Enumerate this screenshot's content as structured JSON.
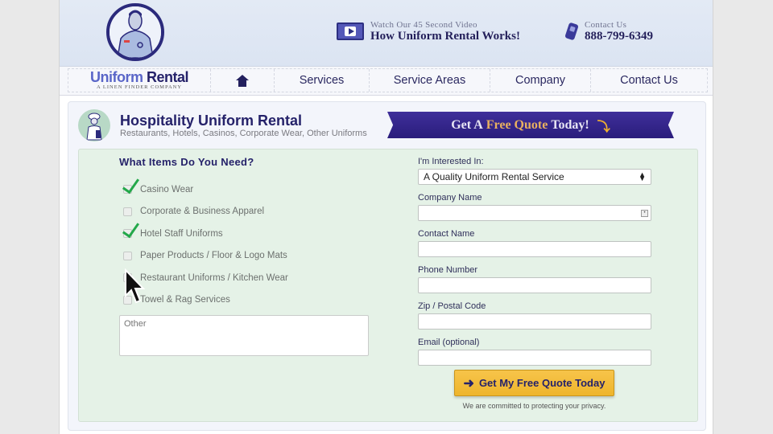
{
  "header": {
    "video_small": "Watch Our 45 Second Video",
    "video_big": "How Uniform Rental Works!",
    "contact_small": "Contact Us",
    "contact_phone": "888-799-6349"
  },
  "nav": {
    "brand_first": "Uniform",
    "brand_second": "Rental",
    "brand_tagline": "A LINEN FINDER COMPANY",
    "items": [
      {
        "label": "Services"
      },
      {
        "label": "Service Areas"
      },
      {
        "label": "Company"
      },
      {
        "label": "Contact Us"
      }
    ]
  },
  "page": {
    "title": "Hospitality Uniform Rental",
    "subtitle": "Restaurants, Hotels, Casinos, Corporate Wear, Other Uniforms",
    "ribbon_pre": "Get A",
    "ribbon_highlight": "Free Quote",
    "ribbon_post": "Today!"
  },
  "form": {
    "items_title": "What Items Do You Need?",
    "items": [
      {
        "label": "Casino Wear",
        "checked": true
      },
      {
        "label": "Corporate & Business Apparel",
        "checked": false
      },
      {
        "label": "Hotel Staff Uniforms",
        "checked": true
      },
      {
        "label": "Paper Products / Floor & Logo Mats",
        "checked": false
      },
      {
        "label": "Restaurant Uniforms / Kitchen Wear",
        "checked": false
      },
      {
        "label": "Towel & Rag Services",
        "checked": false
      }
    ],
    "other_placeholder": "Other",
    "interested_label": "I'm Interested In:",
    "interested_value": "A Quality Uniform Rental Service",
    "company_label": "Company Name",
    "company_value": "",
    "contact_label": "Contact Name",
    "contact_value": "",
    "phone_label": "Phone Number",
    "phone_value": "",
    "zip_label": "Zip / Postal Code",
    "zip_value": "",
    "email_label": "Email (optional)",
    "email_value": "",
    "submit_label": "Get My Free Quote Today",
    "privacy_note": "We are committed to protecting your privacy."
  }
}
